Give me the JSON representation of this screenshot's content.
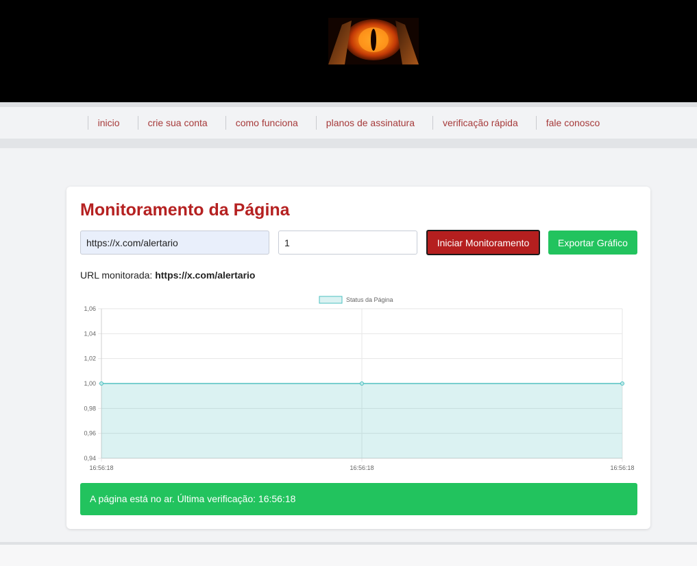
{
  "header": {
    "logo": "eye-of-sauron-logo"
  },
  "nav": {
    "items": [
      {
        "label": "inicio"
      },
      {
        "label": "crie sua conta"
      },
      {
        "label": "como funciona"
      },
      {
        "label": "planos de assinatura"
      },
      {
        "label": "verificação rápida"
      },
      {
        "label": "fale conosco"
      }
    ],
    "link_color": "#a63a3a"
  },
  "main": {
    "title": "Monitoramento da Página",
    "url_input_value": "https://x.com/alertario",
    "interval_input_value": "1",
    "start_button_label": "Iniciar Monitoramento",
    "export_button_label": "Exportar Gráfico",
    "monitored_label": "URL monitorada:",
    "monitored_url": "https://x.com/alertario",
    "status_message": "A página está no ar. Última verificação: 16:56:18",
    "colors": {
      "title": "#b52121",
      "start_button": "#b51f1f",
      "export_button": "#22c35e",
      "status": "#22c35e"
    }
  },
  "chart_data": {
    "type": "area",
    "x": [
      "16:56:18",
      "16:56:18",
      "16:56:18"
    ],
    "y_tick_labels": [
      "1,06",
      "1,04",
      "1,02",
      "1,00",
      "0,98",
      "0,96",
      "0,94"
    ],
    "series": [
      {
        "name": "Status da Página",
        "values": [
          1,
          1,
          1
        ],
        "color": "#4bc0c0"
      }
    ],
    "ylim": [
      0.94,
      1.06
    ],
    "grid": true,
    "legend": "top"
  }
}
